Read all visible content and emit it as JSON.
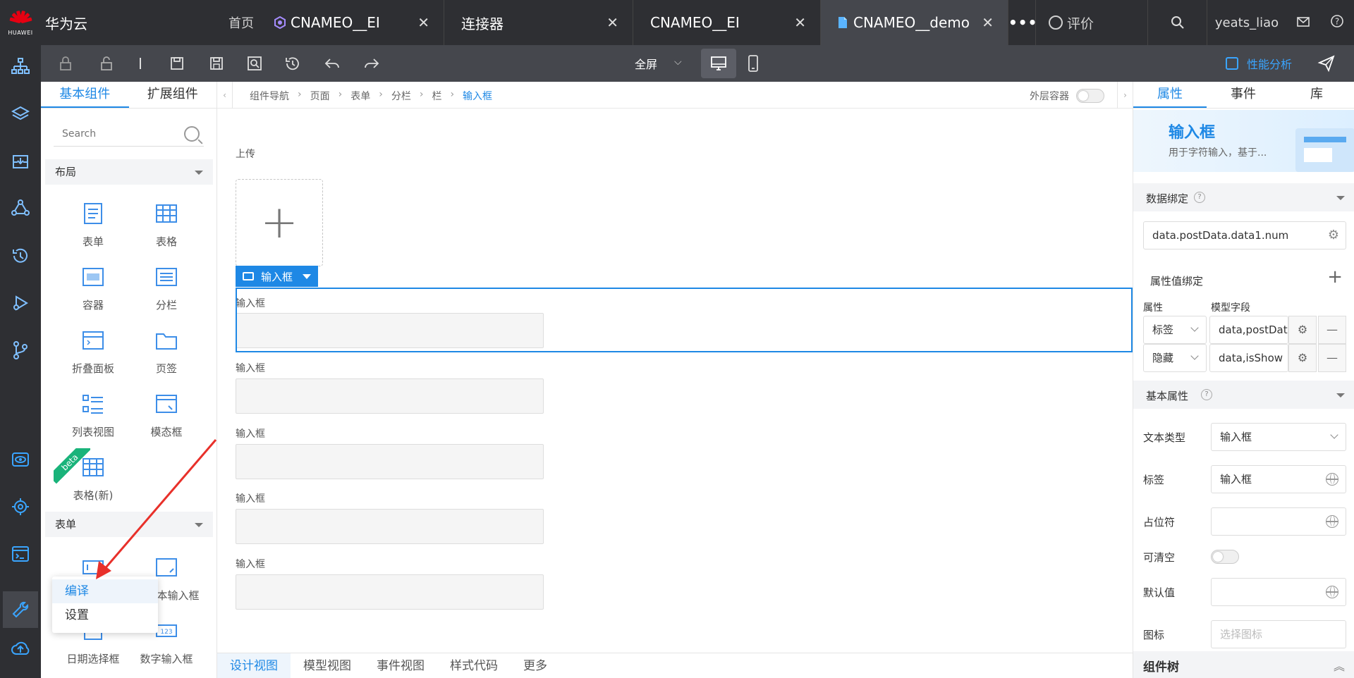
{
  "topbar": {
    "brand": "华为云",
    "logo_text": "HUAWEI",
    "home": "首页",
    "tabs": [
      {
        "label": "CNAMEO__EI",
        "icon": "hexagon-icon"
      },
      {
        "label": "连接器",
        "icon": ""
      },
      {
        "label": "CNAMEO__EI",
        "icon": ""
      },
      {
        "label": "CNAMEO__demo",
        "icon": "file-icon",
        "active": true
      }
    ],
    "more": "•••",
    "rate": "评价",
    "user": "yeats_liao"
  },
  "toolbar": {
    "fullscreen": "全屏",
    "perf": "性能分析"
  },
  "left_panel": {
    "tabs": [
      "基本组件",
      "扩展组件"
    ],
    "search_placeholder": "Search",
    "sections": {
      "layout": "布局",
      "form": "表单"
    },
    "layout_components": [
      "表单",
      "表格",
      "容器",
      "分栏",
      "折叠面板",
      "页签",
      "列表视图",
      "模态框",
      "表格(新)"
    ],
    "form_components": [
      "文本输入框",
      "日期选择框",
      "数字输入框"
    ],
    "beta": "beta"
  },
  "context_menu": {
    "items": [
      "编译",
      "设置"
    ]
  },
  "canvas": {
    "breadcrumb": [
      "组件导航",
      "页面",
      "表单",
      "分栏",
      "栏",
      "输入框"
    ],
    "outer_container": "外层容器",
    "upload_label": "上传",
    "selected_tag": "输入框",
    "field_label": "输入框",
    "view_tabs": [
      "设计视图",
      "模型视图",
      "事件视图",
      "样式代码",
      "更多"
    ]
  },
  "props": {
    "tabs": [
      "属性",
      "事件",
      "库"
    ],
    "banner_title": "输入框",
    "banner_desc": "用于字符输入，基于...",
    "data_binding": "数据绑定",
    "binding_value": "data.postData.data1.num",
    "attr_binding": "属性值绑定",
    "col_attr": "属性",
    "col_field": "模型字段",
    "rows": [
      {
        "attr": "标签",
        "field": "data,postDat"
      },
      {
        "attr": "隐藏",
        "field": "data,isShow"
      }
    ],
    "basic": "基本属性",
    "text_type_label": "文本类型",
    "text_type_value": "输入框",
    "label_label": "标签",
    "label_value": "输入框",
    "placeholder_label": "占位符",
    "clearable_label": "可清空",
    "default_label": "默认值",
    "icon_label": "图标",
    "icon_placeholder": "选择图标",
    "tree": "组件树"
  }
}
